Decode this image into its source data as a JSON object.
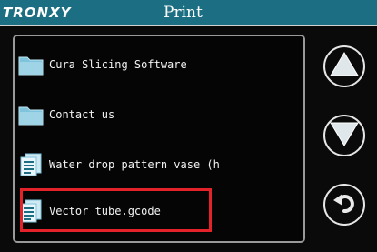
{
  "header": {
    "brand": "TRONXY",
    "title": "Print"
  },
  "files": [
    {
      "name": "Cura Slicing Software",
      "icon": "folder-icon"
    },
    {
      "name": "Contact us",
      "icon": "folder-icon"
    },
    {
      "name": "Water drop pattern vase (h",
      "icon": "document-icon"
    },
    {
      "name": "Vector tube.gcode",
      "icon": "document-icon"
    }
  ],
  "controls": {
    "up": "up-arrow-icon",
    "down": "down-arrow-icon",
    "back": "back-arrow-icon"
  },
  "colors": {
    "titlebar": "#1c6f82",
    "highlight": "#e3222a",
    "folder": "#7fc4dc"
  }
}
